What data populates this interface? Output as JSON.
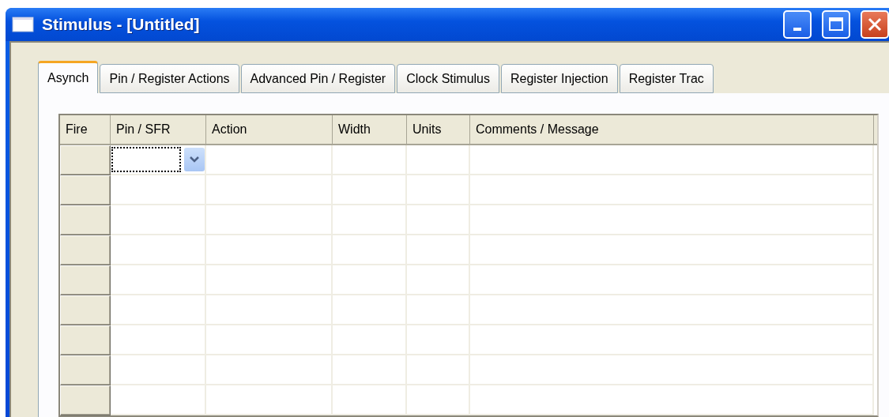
{
  "window": {
    "title": "Stimulus - [Untitled]"
  },
  "tabs": [
    {
      "label": "Asynch",
      "selected": true
    },
    {
      "label": "Pin / Register Actions",
      "selected": false
    },
    {
      "label": "Advanced Pin / Register",
      "selected": false
    },
    {
      "label": "Clock Stimulus",
      "selected": false
    },
    {
      "label": "Register Injection",
      "selected": false
    },
    {
      "label": "Register Trac",
      "selected": false
    }
  ],
  "table": {
    "columns": [
      "Fire",
      "Pin / SFR",
      "Action",
      "Width",
      "Units",
      "Comments / Message"
    ],
    "rows": [
      {
        "kind": "editing"
      },
      {
        "kind": "empty"
      },
      {
        "kind": "empty"
      },
      {
        "kind": "empty"
      },
      {
        "kind": "empty"
      },
      {
        "kind": "empty"
      },
      {
        "kind": "empty"
      },
      {
        "kind": "empty"
      },
      {
        "kind": "empty"
      }
    ]
  }
}
